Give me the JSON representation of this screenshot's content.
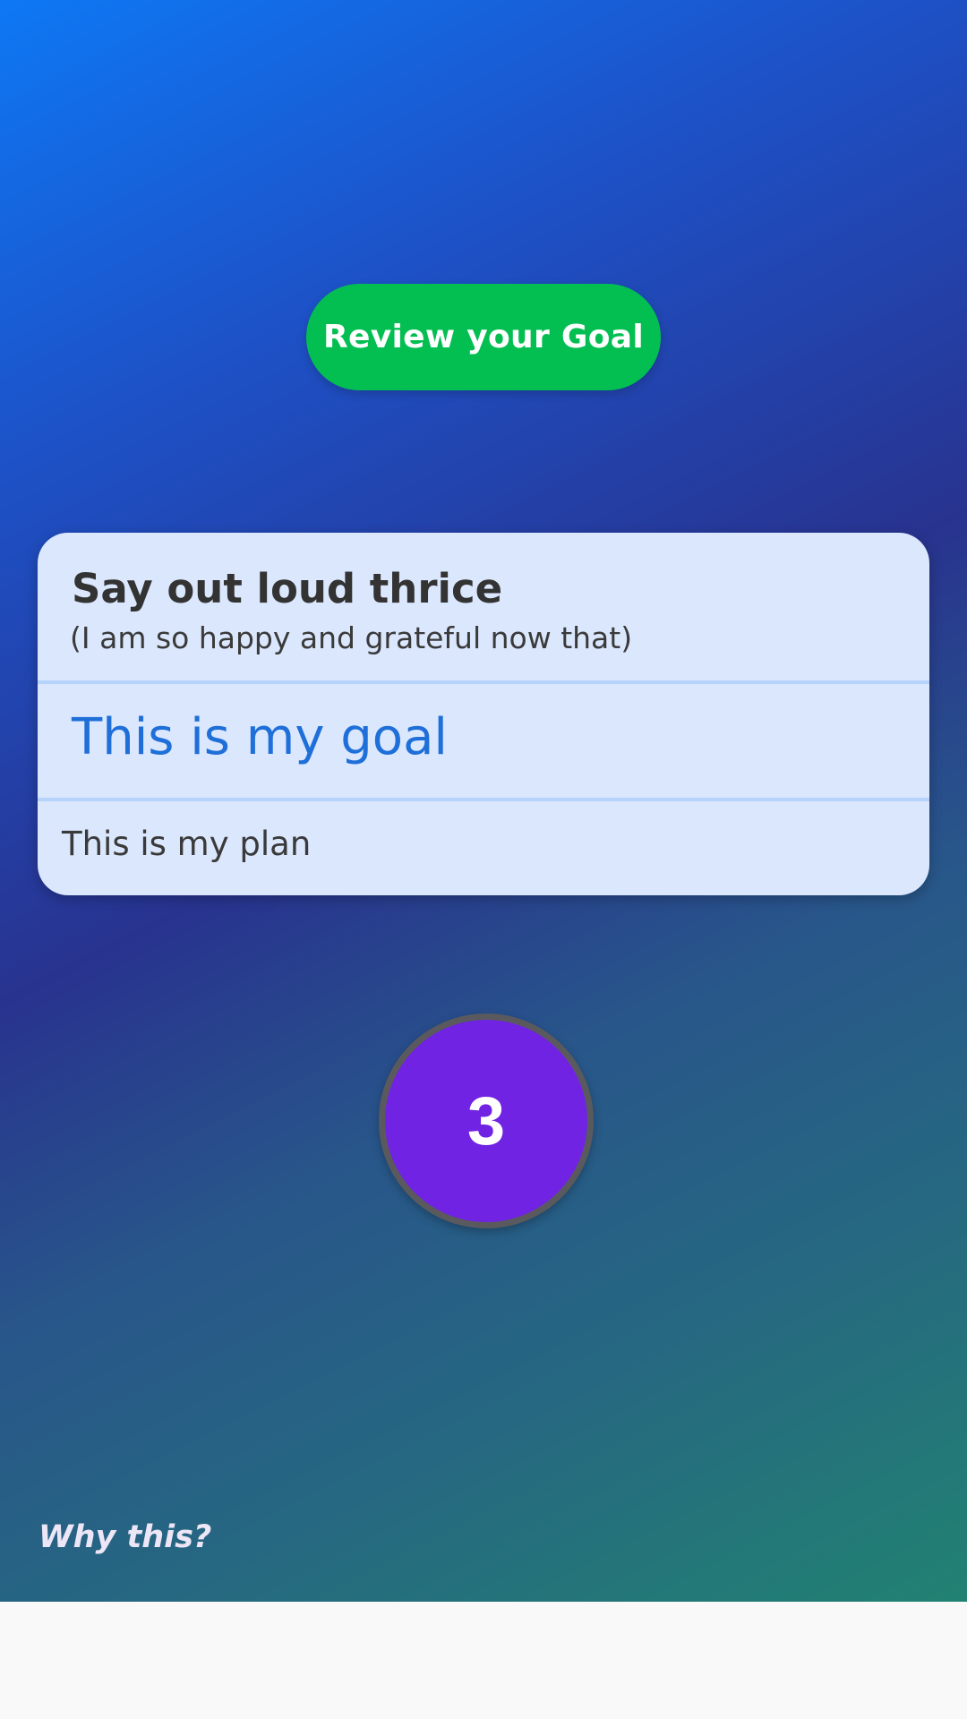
{
  "header": {
    "review_button_label": "Review your Goal"
  },
  "card": {
    "instruction_title": "Say out loud thrice",
    "instruction_subtitle": "(I am so happy and grateful now that)",
    "goal_text": "This is my goal",
    "plan_text": "This is my plan"
  },
  "counter": {
    "value": "3"
  },
  "footer": {
    "why_link": "Why this?"
  },
  "colors": {
    "background_gradient": [
      "#0e78f4",
      "#28338f",
      "#218272"
    ],
    "review_button": "#03bf52",
    "card_background": "#dbe7fd",
    "card_divider": "#b6d3fb",
    "goal_text": "#1f6fd9",
    "counter_fill": "#7023e2",
    "counter_border": "#5a5a5e",
    "bottom_bar": "#f9f9fa"
  }
}
